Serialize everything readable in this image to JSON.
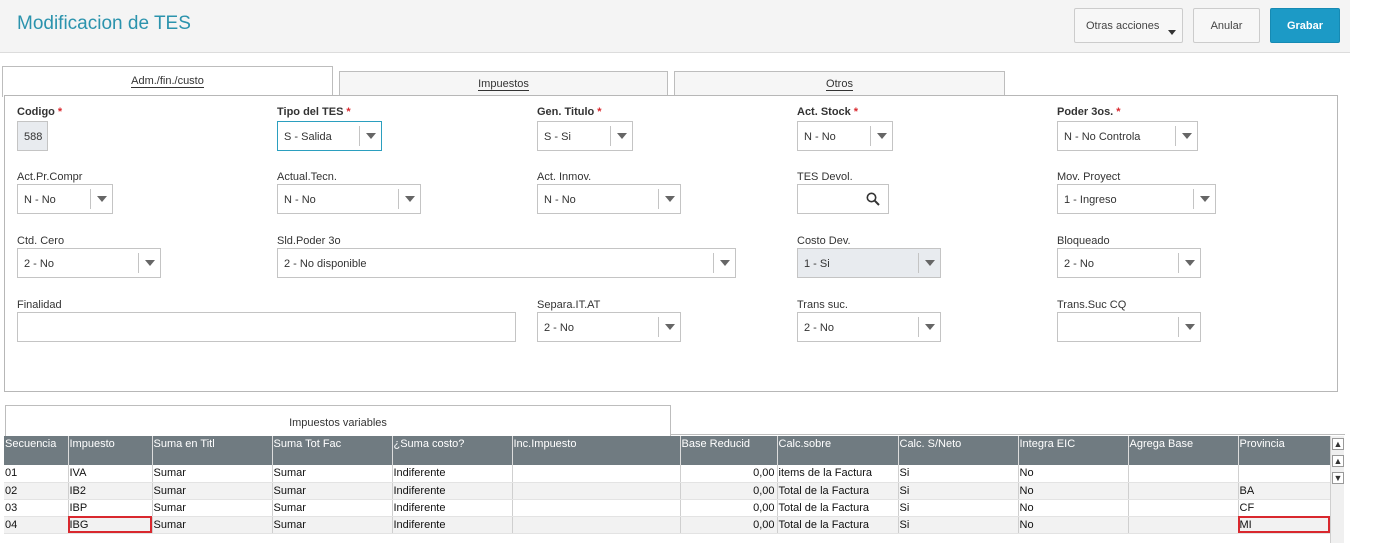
{
  "header": {
    "title": "Modificacion de TES",
    "otras_label": "Otras acciones",
    "anular_label": "Anular",
    "grabar_label": "Grabar"
  },
  "tabs": [
    {
      "label": "Adm./fin./custo"
    },
    {
      "label": "Impuestos"
    },
    {
      "label": "Otros"
    }
  ],
  "form": {
    "codigo": {
      "label": "Codigo",
      "value": "588"
    },
    "tipo_tes": {
      "label": "Tipo del TES",
      "value": "S - Salida"
    },
    "gen_titulo": {
      "label": "Gen. Titulo",
      "value": "S - Si"
    },
    "act_stock": {
      "label": "Act. Stock",
      "value": "N - No"
    },
    "poder_3os": {
      "label": "Poder 3os.",
      "value": "N - No Controla"
    },
    "act_pr_compr": {
      "label": "Act.Pr.Compr",
      "value": "N - No"
    },
    "actual_tecn": {
      "label": "Actual.Tecn.",
      "value": "N - No"
    },
    "act_inmov": {
      "label": "Act. Inmov.",
      "value": "N - No"
    },
    "tes_devol": {
      "label": "TES Devol.",
      "value": ""
    },
    "mov_proyect": {
      "label": "Mov. Proyect",
      "value": "1 - Ingreso"
    },
    "ctd_cero": {
      "label": "Ctd. Cero",
      "value": "2 - No"
    },
    "sld_poder": {
      "label": "Sld.Poder 3o",
      "value": "2 - No disponible"
    },
    "costo_dev": {
      "label": "Costo Dev.",
      "value": "1 - Si"
    },
    "bloqueado": {
      "label": "Bloqueado",
      "value": "2 - No"
    },
    "finalidad": {
      "label": "Finalidad",
      "value": ""
    },
    "separa_it": {
      "label": "Separa.IT.AT",
      "value": "2 - No"
    },
    "trans_suc": {
      "label": "Trans suc.",
      "value": "2 - No"
    },
    "trans_suc_cq": {
      "label": "Trans.Suc CQ",
      "value": ""
    }
  },
  "grid": {
    "tab_label": "Impuestos variables",
    "columns": [
      "Secuencia",
      "Impuesto",
      "Suma en Titl",
      "Suma Tot Fac",
      "¿Suma costo?",
      "Inc.Impuesto",
      "Base Reducid",
      "Calc.sobre",
      "Calc. S/Neto",
      "Integra EIC",
      "Agrega Base",
      "Provincia"
    ],
    "rows": [
      [
        "01",
        "IVA",
        "Sumar",
        "Sumar",
        "Indiferente",
        "",
        "0,00",
        "items de la Factura",
        "Si",
        "No",
        "",
        ""
      ],
      [
        "02",
        "IB2",
        "Sumar",
        "Sumar",
        "Indiferente",
        "",
        "0,00",
        "Total de la Factura",
        "Si",
        "No",
        "",
        "BA"
      ],
      [
        "03",
        "IBP",
        "Sumar",
        "Sumar",
        "Indiferente",
        "",
        "0,00",
        "Total de la Factura",
        "Si",
        "No",
        "",
        "CF"
      ],
      [
        "04",
        "IBG",
        "Sumar",
        "Sumar",
        "Indiferente",
        "",
        "0,00",
        "Total de la Factura",
        "Si",
        "No",
        "",
        "MI"
      ]
    ]
  }
}
